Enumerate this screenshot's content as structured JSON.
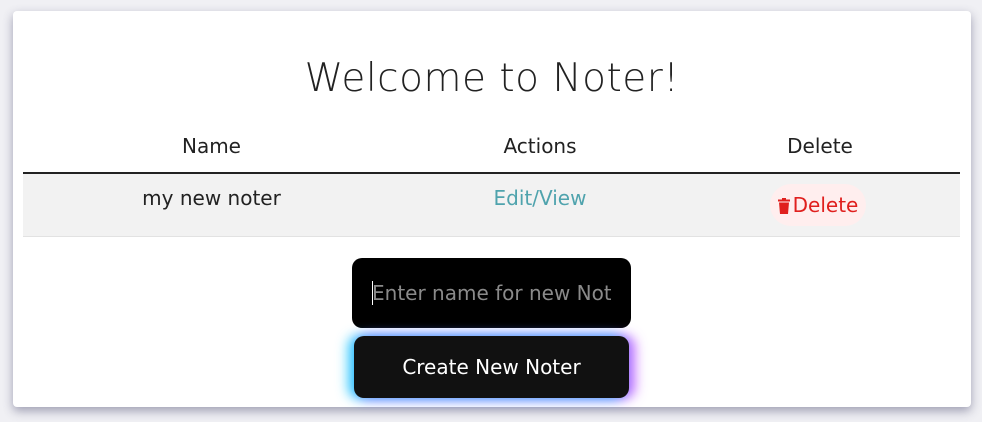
{
  "app": {
    "title": "Welcome to Noter!"
  },
  "table": {
    "headers": [
      "Name",
      "Actions",
      "Delete"
    ],
    "rows": [
      {
        "name": "my new noter",
        "action_label": "Edit/View",
        "delete_label": "Delete"
      }
    ]
  },
  "form": {
    "input_value": "",
    "input_placeholder": "Enter name for new Noter",
    "create_label": "Create New Noter"
  },
  "icons": {
    "delete": "trash-icon"
  },
  "colors": {
    "link": "#4fa3ad",
    "danger": "#e0201e",
    "danger_bg": "#ffeeee",
    "button_bg": "#111111"
  }
}
